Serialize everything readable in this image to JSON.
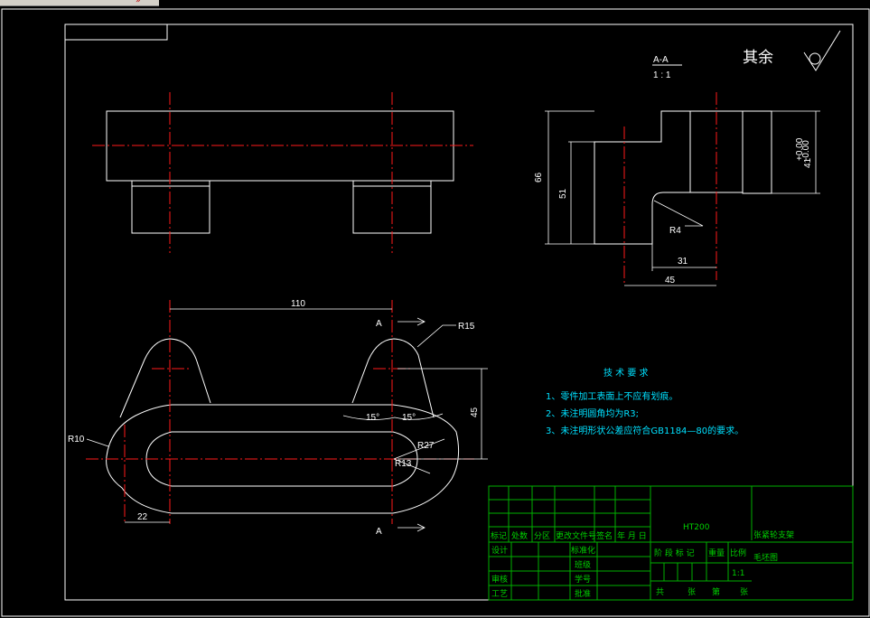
{
  "toolbar_fragment": "»",
  "section": {
    "label": "A-A",
    "scale": "1 : 1"
  },
  "surface_finish_note": "其余",
  "dims": {
    "d66": "66",
    "d51": "51",
    "d41": "41",
    "tol_upper": "+0.00",
    "tol_lower": "-0.00",
    "r4": "R4",
    "d31": "31",
    "d45_section": "45",
    "d110": "110",
    "r15": "R15",
    "d45_side": "45",
    "ang1": "15°",
    "ang2": "15°",
    "r10": "R10",
    "r27": "R27",
    "r13": "R13",
    "d22": "22",
    "cut_a_top": "A",
    "cut_a_bottom": "A"
  },
  "tech_req": {
    "title": "技  术  要  求",
    "line1": "1、零件加工表面上不应有划痕。",
    "line2": "2、未注明圆角均为R3;",
    "line3": "3、未注明形状公差应符合GB1184—80的要求。"
  },
  "title_block": {
    "material": "HT200",
    "drawing_name_1": "张紧轮支架",
    "drawing_name_2": "毛坯图",
    "header": [
      "标记",
      "处数",
      "分区",
      "更改文件号",
      "签名",
      "年 月 日"
    ],
    "design": "设计",
    "standardize": "标准化",
    "class": "班级",
    "review": "审核",
    "student_no": "学号",
    "process": "工艺",
    "approve": "批准",
    "stage_mark": "阶 段 标 记",
    "weight": "重量",
    "ratio": "比例",
    "ratio_value": "1:1",
    "total": "共",
    "sheets": "张",
    "nth": "第",
    "sheet": "张"
  }
}
